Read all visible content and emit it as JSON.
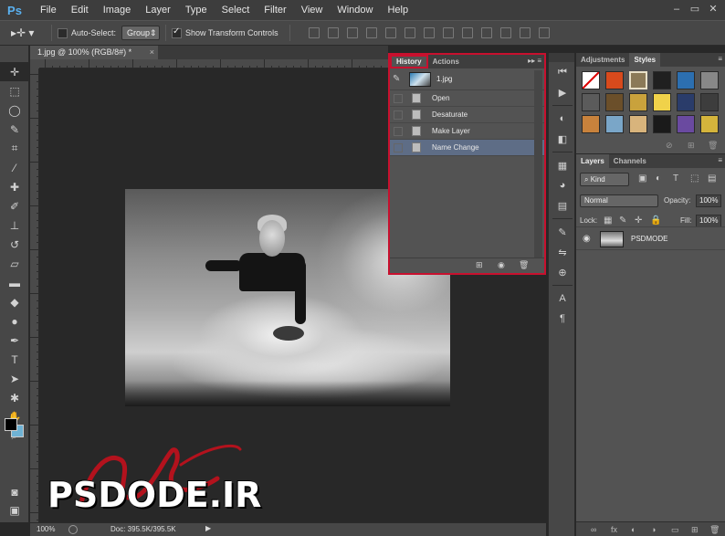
{
  "menubar": {
    "app_logo": "Ps",
    "items": [
      "File",
      "Edit",
      "Image",
      "Layer",
      "Type",
      "Select",
      "Filter",
      "View",
      "Window",
      "Help"
    ],
    "minimize": "–",
    "restore": "▭",
    "close": "✕"
  },
  "options_bar": {
    "tool_glyph": "▸✛ ▾",
    "auto_select_label": "Auto-Select:",
    "auto_select_checked": false,
    "group_value": "Group",
    "show_transform_label": "Show Transform Controls",
    "show_transform_checked": true
  },
  "toolbar": {
    "tools": [
      {
        "name": "move-tool-icon",
        "glyph": "✛"
      },
      {
        "name": "marquee-tool-icon",
        "glyph": "⬚"
      },
      {
        "name": "lasso-tool-icon",
        "glyph": "◯"
      },
      {
        "name": "quick-select-tool-icon",
        "glyph": "✎"
      },
      {
        "name": "crop-tool-icon",
        "glyph": "⌗"
      },
      {
        "name": "eyedropper-tool-icon",
        "glyph": "⁄"
      },
      {
        "name": "healing-brush-tool-icon",
        "glyph": "✚"
      },
      {
        "name": "brush-tool-icon",
        "glyph": "✐"
      },
      {
        "name": "clone-stamp-tool-icon",
        "glyph": "⊥"
      },
      {
        "name": "history-brush-tool-icon",
        "glyph": "↺"
      },
      {
        "name": "eraser-tool-icon",
        "glyph": "▱"
      },
      {
        "name": "gradient-tool-icon",
        "glyph": "▬"
      },
      {
        "name": "blur-tool-icon",
        "glyph": "◆"
      },
      {
        "name": "dodge-tool-icon",
        "glyph": "●"
      },
      {
        "name": "pen-tool-icon",
        "glyph": "✒"
      },
      {
        "name": "type-tool-icon",
        "glyph": "T"
      },
      {
        "name": "path-selection-tool-icon",
        "glyph": "➤"
      },
      {
        "name": "custom-shape-tool-icon",
        "glyph": "✱"
      },
      {
        "name": "hand-tool-icon",
        "glyph": "✋"
      },
      {
        "name": "zoom-tool-icon",
        "glyph": "⌕"
      }
    ],
    "foreground_color": "#000000",
    "background_color": "#6fb2d4",
    "quick_mask_glyph": "◙",
    "screen_mode_glyph": "▣"
  },
  "document": {
    "tab_title": "1.jpg @ 100% (RGB/8#) *",
    "tab_close": "×"
  },
  "watermark": {
    "text": "PSDODE.IR"
  },
  "status_bar": {
    "zoom": "100%",
    "doc_info": "Doc: 395.5K/395.5K",
    "arrow": "▶"
  },
  "history_panel": {
    "tabs": [
      "History",
      "Actions"
    ],
    "active_tab": "History",
    "menu_glyph": "▸▸ ≡",
    "snapshot_name": "1.jpg",
    "brush_glyph": "✎",
    "steps": [
      {
        "label": "Open",
        "selected": false
      },
      {
        "label": "Desaturate",
        "selected": false
      },
      {
        "label": "Make Layer",
        "selected": false
      },
      {
        "label": "Name Change",
        "selected": true
      }
    ],
    "footer_icons": [
      "new-document-from-state-icon",
      "camera-icon",
      "trash-icon"
    ],
    "footer_glyphs": [
      "⊞",
      "◉",
      "🗑"
    ],
    "highlight_color": "#c8102e",
    "selected_row_color": "#5e6d86"
  },
  "icon_column": {
    "icons": [
      {
        "name": "history-panel-icon",
        "glyph": "⏮"
      },
      {
        "name": "actions-panel-icon",
        "glyph": "▶"
      },
      {
        "name": "adjustments-panel-icon",
        "glyph": "◐"
      },
      {
        "name": "masks-panel-icon",
        "glyph": "◧"
      },
      {
        "name": "swatches-panel-icon",
        "glyph": "▦"
      },
      {
        "name": "color-panel-icon",
        "glyph": "◕"
      },
      {
        "name": "layer-comps-icon",
        "glyph": "▤"
      },
      {
        "name": "brush-presets-icon",
        "glyph": "✎"
      },
      {
        "name": "brush-panel-icon",
        "glyph": "⇋"
      },
      {
        "name": "clone-source-icon",
        "glyph": "⊕"
      },
      {
        "name": "character-panel-icon",
        "glyph": "A"
      },
      {
        "name": "paragraph-panel-icon",
        "glyph": "¶"
      }
    ]
  },
  "adjustments_styles": {
    "tabs": [
      "Adjustments",
      "Styles"
    ],
    "active_tab": "Styles",
    "menu_glyph": "≡",
    "style_swatches": [
      "#ffffff",
      "#d84a1c",
      "#8b7a58",
      "#202020",
      "#2c6fb0",
      "#888888",
      "#5b5b5b",
      "#6b4f2a",
      "#c9a23c",
      "#f0d24a",
      "#2a3c6a",
      "#3d3d3d",
      "#c8823c",
      "#7aa6c8",
      "#d8b47c",
      "#1a1a1a",
      "#6a4aa0",
      "#d4b43c"
    ],
    "footer_glyphs": [
      "⊘",
      "⊞",
      "🗑"
    ]
  },
  "layers_panel": {
    "tabs": [
      "Layers",
      "Channels"
    ],
    "active_tab": "Layers",
    "menu_glyph": "≡",
    "kind_value": "Kind",
    "filter_glyphs": [
      "▣",
      "◐",
      "T",
      "⬚",
      "▤"
    ],
    "blend_mode": "Normal",
    "opacity_label": "Opacity:",
    "opacity_value": "100%",
    "lock_label": "Lock:",
    "lock_glyphs": [
      "▦",
      "✎",
      "✛",
      "🔒"
    ],
    "fill_label": "Fill:",
    "fill_value": "100%",
    "layers": [
      {
        "name": "PSDMODE",
        "visible": true
      }
    ],
    "eye_glyph": "◉",
    "footer_glyphs": [
      "∞",
      "fx",
      "◐",
      "◑",
      "▭",
      "⊞",
      "🗑"
    ]
  }
}
